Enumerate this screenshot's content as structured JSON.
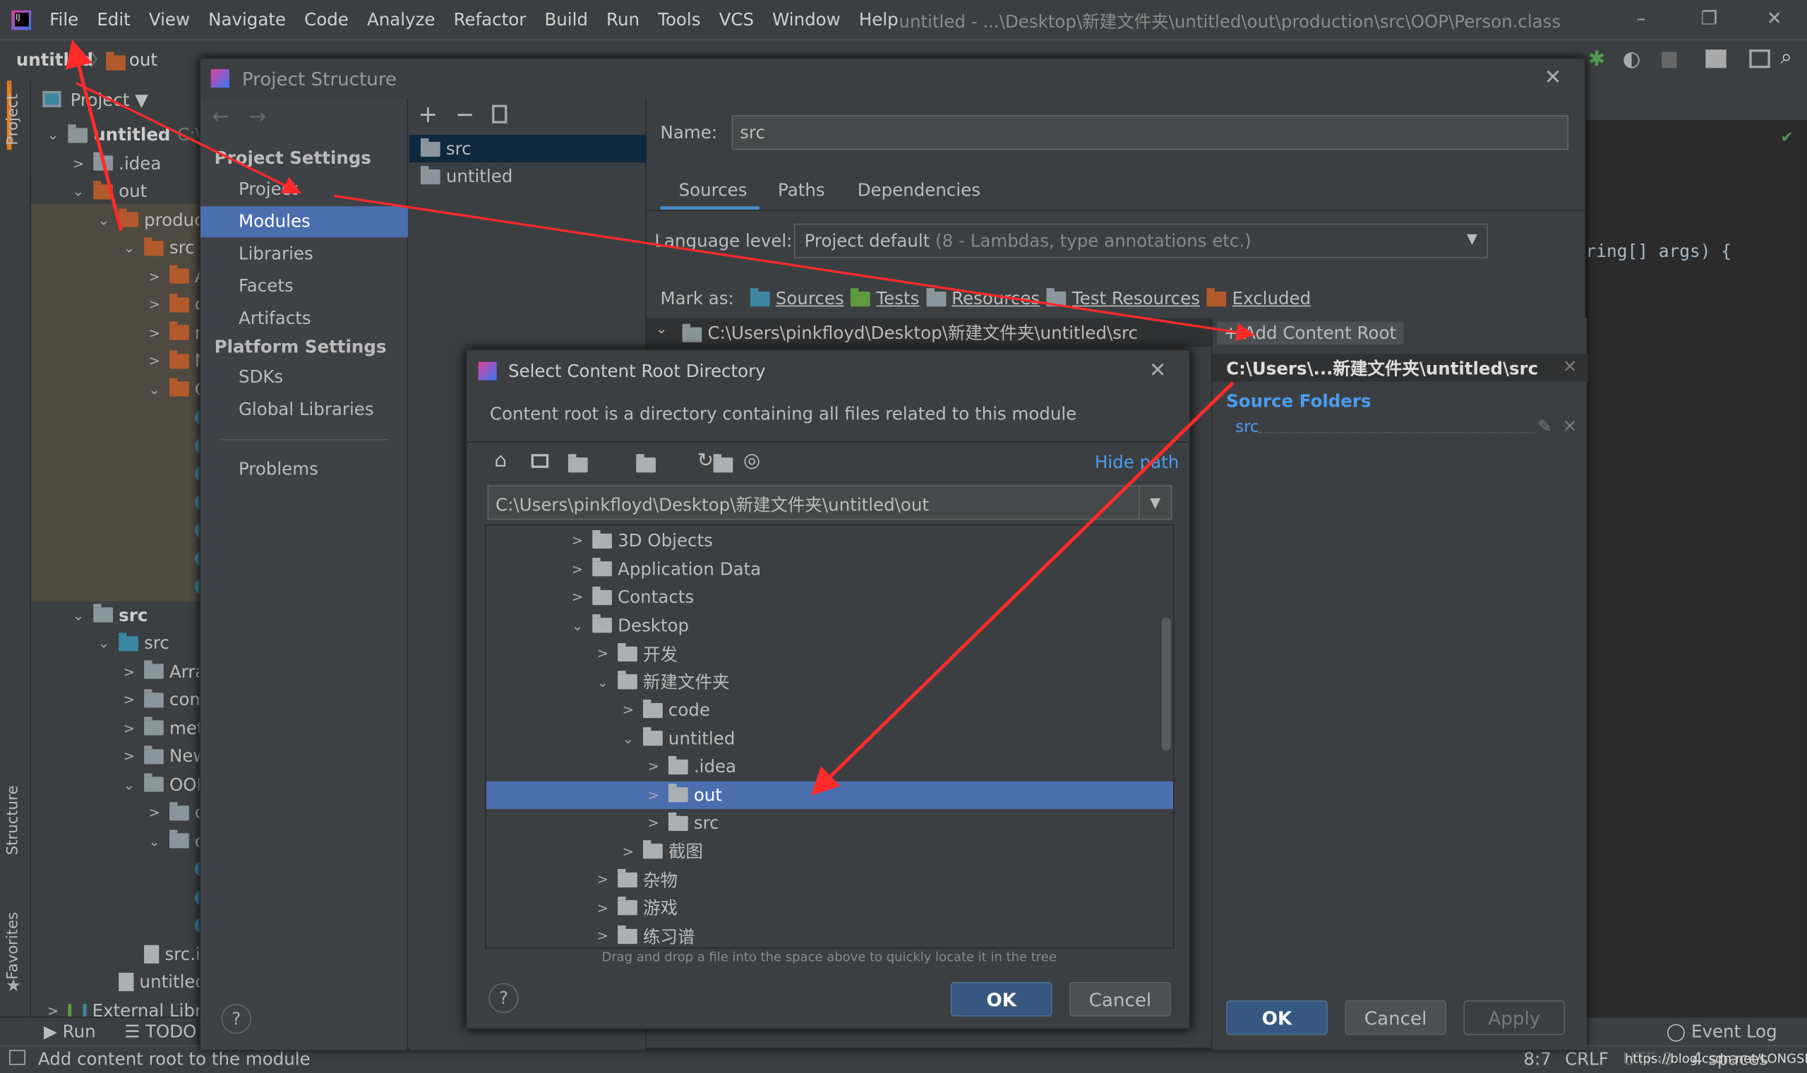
{
  "window": {
    "title": "untitled - ...\\Desktop\\新建文件夹\\untitled\\out\\production\\src\\OOP\\Person.class",
    "minimize": "–",
    "restore": "❐",
    "close": "✕"
  },
  "menu": [
    "File",
    "Edit",
    "View",
    "Navigate",
    "Code",
    "Analyze",
    "Refactor",
    "Build",
    "Run",
    "Tools",
    "VCS",
    "Window",
    "Help"
  ],
  "breadcrumb": {
    "project": "untitled",
    "folder": "out"
  },
  "side_tabs": {
    "project": "Project",
    "structure": "Structure",
    "favorites": "Favorites"
  },
  "project_panel": {
    "header": "Project ▼",
    "rows": [
      {
        "label": "untitled",
        "extra": "C:\\U",
        "lvl": 0,
        "chev": "⌄",
        "icon": "grey",
        "bold": true
      },
      {
        "label": ".idea",
        "lvl": 1,
        "chev": ">",
        "icon": "grey"
      },
      {
        "label": "out",
        "lvl": 1,
        "chev": "⌄",
        "icon": "orange",
        "selected": true
      },
      {
        "label": "produc",
        "lvl": 2,
        "chev": "⌄",
        "icon": "orange"
      },
      {
        "label": "src",
        "lvl": 3,
        "chev": "⌄",
        "icon": "orange"
      },
      {
        "label": "A",
        "lvl": 4,
        "chev": ">",
        "icon": "orange"
      },
      {
        "label": "c",
        "lvl": 4,
        "chev": ">",
        "icon": "orange"
      },
      {
        "label": "r",
        "lvl": 4,
        "chev": ">",
        "icon": "orange"
      },
      {
        "label": "N",
        "lvl": 4,
        "chev": ">",
        "icon": "orange"
      },
      {
        "label": "C",
        "lvl": 4,
        "chev": "⌄",
        "icon": "orange"
      },
      {
        "label": "",
        "lvl": 5,
        "icon": "class"
      },
      {
        "label": "",
        "lvl": 5,
        "icon": "class"
      },
      {
        "label": "",
        "lvl": 5,
        "icon": "class"
      },
      {
        "label": "",
        "lvl": 5,
        "icon": "class"
      },
      {
        "label": "",
        "lvl": 5,
        "icon": "class"
      },
      {
        "label": "",
        "lvl": 5,
        "icon": "class"
      },
      {
        "label": "",
        "lvl": 5,
        "icon": "class"
      },
      {
        "label": "src",
        "lvl": 1,
        "chev": "⌄",
        "icon": "grey",
        "bold": true
      },
      {
        "label": "src",
        "lvl": 2,
        "chev": "⌄",
        "icon": "blue"
      },
      {
        "label": "Arra",
        "lvl": 3,
        "chev": ">",
        "icon": "grey"
      },
      {
        "label": "com",
        "lvl": 3,
        "chev": ">",
        "icon": "grey"
      },
      {
        "label": "met",
        "lvl": 3,
        "chev": ">",
        "icon": "grey"
      },
      {
        "label": "New",
        "lvl": 3,
        "chev": ">",
        "icon": "grey"
      },
      {
        "label": "OOI",
        "lvl": 3,
        "chev": "⌄",
        "icon": "grey"
      },
      {
        "label": "c",
        "lvl": 4,
        "chev": ">",
        "icon": "grey"
      },
      {
        "label": "c",
        "lvl": 4,
        "chev": "⌄",
        "icon": "grey"
      },
      {
        "label": "",
        "lvl": 5,
        "icon": "class"
      },
      {
        "label": "",
        "lvl": 5,
        "icon": "class"
      },
      {
        "label": "",
        "lvl": 5,
        "icon": "class"
      },
      {
        "label": "src.iml",
        "lvl": 3,
        "icon": "file"
      },
      {
        "label": "untitled.im",
        "lvl": 2,
        "icon": "file"
      },
      {
        "label": "External Libra",
        "lvl": 0,
        "chev": ">",
        "icon": "lib"
      }
    ]
  },
  "editor": {
    "code": "ring[] args) {"
  },
  "bottom_bar": {
    "run": "Run",
    "todo": "TODO",
    "event_log": "Event Log"
  },
  "status": {
    "message": "Add content root to the module",
    "position": "8:7",
    "line_sep": "CRLF",
    "encoding": "UTF-8",
    "indent": "4 spaces",
    "watermark": "https://blog.csdn.net/LONGSESON"
  },
  "project_structure": {
    "title": "Project Structure",
    "project_settings": "Project Settings",
    "project_items": [
      "Project",
      "Modules",
      "Libraries",
      "Facets",
      "Artifacts"
    ],
    "platform_settings": "Platform Settings",
    "platform_items": [
      "SDKs",
      "Global Libraries"
    ],
    "problems": "Problems",
    "modules": [
      "src",
      "untitled"
    ],
    "name_label": "Name:",
    "name_value": "src",
    "tabs": [
      "Sources",
      "Paths",
      "Dependencies"
    ],
    "language_level_label": "Language level:",
    "language_level_value": "Project default",
    "language_level_hint": "(8 - Lambdas, type annotations etc.)",
    "mark_as_label": "Mark as:",
    "mark_as": [
      {
        "label": "Sources",
        "color": "#3d86a1"
      },
      {
        "label": "Tests",
        "color": "#5f9a40"
      },
      {
        "label": "Resources",
        "color": "#8b959c"
      },
      {
        "label": "Test Resources",
        "color": "#8b959c"
      },
      {
        "label": "Excluded",
        "color": "#b35a2c"
      }
    ],
    "content_root_path": "C:\\Users\\pinkfloyd\\Desktop\\新建文件夹\\untitled\\src",
    "add_content_root": "+ Add Content Root",
    "root_short": "C:\\Users\\...新建文件夹\\untitled\\src",
    "source_folders_label": "Source Folders",
    "source_folder": "src",
    "ok": "OK",
    "cancel": "Cancel",
    "apply": "Apply",
    "help": "?"
  },
  "select_dialog": {
    "title": "Select Content Root Directory",
    "description": "Content root is a directory containing all files related to this module",
    "hide_path": "Hide path",
    "path": "C:\\Users\\pinkfloyd\\Desktop\\新建文件夹\\untitled\\out",
    "tree": [
      {
        "label": "3D Objects",
        "lvl": 0,
        "chev": ">"
      },
      {
        "label": "Application Data",
        "lvl": 0,
        "chev": ">"
      },
      {
        "label": "Contacts",
        "lvl": 0,
        "chev": ">"
      },
      {
        "label": "Desktop",
        "lvl": 0,
        "chev": "⌄"
      },
      {
        "label": "开发",
        "lvl": 1,
        "chev": ">"
      },
      {
        "label": "新建文件夹",
        "lvl": 1,
        "chev": "⌄"
      },
      {
        "label": "code",
        "lvl": 2,
        "chev": ">"
      },
      {
        "label": "untitled",
        "lvl": 2,
        "chev": "⌄"
      },
      {
        "label": ".idea",
        "lvl": 3,
        "chev": ">"
      },
      {
        "label": "out",
        "lvl": 3,
        "chev": ">",
        "selected": true
      },
      {
        "label": "src",
        "lvl": 3,
        "chev": ">"
      },
      {
        "label": "截图",
        "lvl": 2,
        "chev": ">"
      },
      {
        "label": "杂物",
        "lvl": 1,
        "chev": ">"
      },
      {
        "label": "游戏",
        "lvl": 1,
        "chev": ">"
      },
      {
        "label": "练习谱",
        "lvl": 1,
        "chev": ">"
      }
    ],
    "hint": "Drag and drop a file into the space above to quickly locate it in the tree",
    "ok": "OK",
    "cancel": "Cancel",
    "help": "?"
  },
  "colors": {
    "accent": "#4b6eaf",
    "annotation_arrow": "#ff2a2a"
  }
}
